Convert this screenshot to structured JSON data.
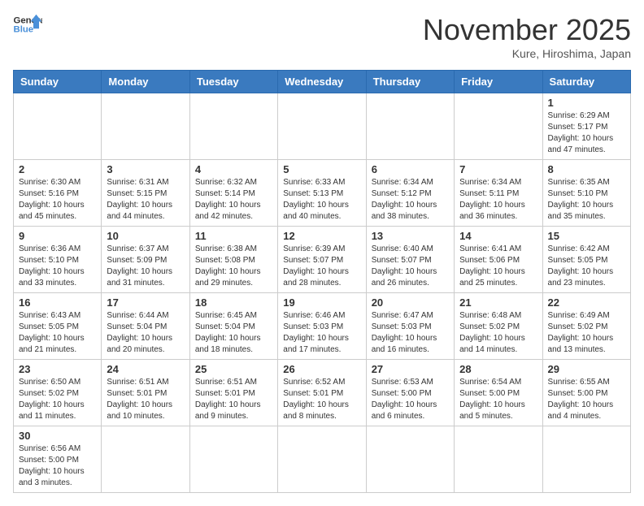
{
  "logo": {
    "text_general": "General",
    "text_blue": "Blue"
  },
  "header": {
    "month": "November 2025",
    "location": "Kure, Hiroshima, Japan"
  },
  "weekdays": [
    "Sunday",
    "Monday",
    "Tuesday",
    "Wednesday",
    "Thursday",
    "Friday",
    "Saturday"
  ],
  "days": [
    {
      "num": "",
      "info": ""
    },
    {
      "num": "",
      "info": ""
    },
    {
      "num": "",
      "info": ""
    },
    {
      "num": "",
      "info": ""
    },
    {
      "num": "",
      "info": ""
    },
    {
      "num": "",
      "info": ""
    },
    {
      "num": "1",
      "info": "Sunrise: 6:29 AM\nSunset: 5:17 PM\nDaylight: 10 hours and 47 minutes."
    },
    {
      "num": "2",
      "info": "Sunrise: 6:30 AM\nSunset: 5:16 PM\nDaylight: 10 hours and 45 minutes."
    },
    {
      "num": "3",
      "info": "Sunrise: 6:31 AM\nSunset: 5:15 PM\nDaylight: 10 hours and 44 minutes."
    },
    {
      "num": "4",
      "info": "Sunrise: 6:32 AM\nSunset: 5:14 PM\nDaylight: 10 hours and 42 minutes."
    },
    {
      "num": "5",
      "info": "Sunrise: 6:33 AM\nSunset: 5:13 PM\nDaylight: 10 hours and 40 minutes."
    },
    {
      "num": "6",
      "info": "Sunrise: 6:34 AM\nSunset: 5:12 PM\nDaylight: 10 hours and 38 minutes."
    },
    {
      "num": "7",
      "info": "Sunrise: 6:34 AM\nSunset: 5:11 PM\nDaylight: 10 hours and 36 minutes."
    },
    {
      "num": "8",
      "info": "Sunrise: 6:35 AM\nSunset: 5:10 PM\nDaylight: 10 hours and 35 minutes."
    },
    {
      "num": "9",
      "info": "Sunrise: 6:36 AM\nSunset: 5:10 PM\nDaylight: 10 hours and 33 minutes."
    },
    {
      "num": "10",
      "info": "Sunrise: 6:37 AM\nSunset: 5:09 PM\nDaylight: 10 hours and 31 minutes."
    },
    {
      "num": "11",
      "info": "Sunrise: 6:38 AM\nSunset: 5:08 PM\nDaylight: 10 hours and 29 minutes."
    },
    {
      "num": "12",
      "info": "Sunrise: 6:39 AM\nSunset: 5:07 PM\nDaylight: 10 hours and 28 minutes."
    },
    {
      "num": "13",
      "info": "Sunrise: 6:40 AM\nSunset: 5:07 PM\nDaylight: 10 hours and 26 minutes."
    },
    {
      "num": "14",
      "info": "Sunrise: 6:41 AM\nSunset: 5:06 PM\nDaylight: 10 hours and 25 minutes."
    },
    {
      "num": "15",
      "info": "Sunrise: 6:42 AM\nSunset: 5:05 PM\nDaylight: 10 hours and 23 minutes."
    },
    {
      "num": "16",
      "info": "Sunrise: 6:43 AM\nSunset: 5:05 PM\nDaylight: 10 hours and 21 minutes."
    },
    {
      "num": "17",
      "info": "Sunrise: 6:44 AM\nSunset: 5:04 PM\nDaylight: 10 hours and 20 minutes."
    },
    {
      "num": "18",
      "info": "Sunrise: 6:45 AM\nSunset: 5:04 PM\nDaylight: 10 hours and 18 minutes."
    },
    {
      "num": "19",
      "info": "Sunrise: 6:46 AM\nSunset: 5:03 PM\nDaylight: 10 hours and 17 minutes."
    },
    {
      "num": "20",
      "info": "Sunrise: 6:47 AM\nSunset: 5:03 PM\nDaylight: 10 hours and 16 minutes."
    },
    {
      "num": "21",
      "info": "Sunrise: 6:48 AM\nSunset: 5:02 PM\nDaylight: 10 hours and 14 minutes."
    },
    {
      "num": "22",
      "info": "Sunrise: 6:49 AM\nSunset: 5:02 PM\nDaylight: 10 hours and 13 minutes."
    },
    {
      "num": "23",
      "info": "Sunrise: 6:50 AM\nSunset: 5:02 PM\nDaylight: 10 hours and 11 minutes."
    },
    {
      "num": "24",
      "info": "Sunrise: 6:51 AM\nSunset: 5:01 PM\nDaylight: 10 hours and 10 minutes."
    },
    {
      "num": "25",
      "info": "Sunrise: 6:51 AM\nSunset: 5:01 PM\nDaylight: 10 hours and 9 minutes."
    },
    {
      "num": "26",
      "info": "Sunrise: 6:52 AM\nSunset: 5:01 PM\nDaylight: 10 hours and 8 minutes."
    },
    {
      "num": "27",
      "info": "Sunrise: 6:53 AM\nSunset: 5:00 PM\nDaylight: 10 hours and 6 minutes."
    },
    {
      "num": "28",
      "info": "Sunrise: 6:54 AM\nSunset: 5:00 PM\nDaylight: 10 hours and 5 minutes."
    },
    {
      "num": "29",
      "info": "Sunrise: 6:55 AM\nSunset: 5:00 PM\nDaylight: 10 hours and 4 minutes."
    },
    {
      "num": "30",
      "info": "Sunrise: 6:56 AM\nSunset: 5:00 PM\nDaylight: 10 hours and 3 minutes."
    },
    {
      "num": "",
      "info": ""
    },
    {
      "num": "",
      "info": ""
    },
    {
      "num": "",
      "info": ""
    },
    {
      "num": "",
      "info": ""
    },
    {
      "num": "",
      "info": ""
    },
    {
      "num": "",
      "info": ""
    }
  ]
}
